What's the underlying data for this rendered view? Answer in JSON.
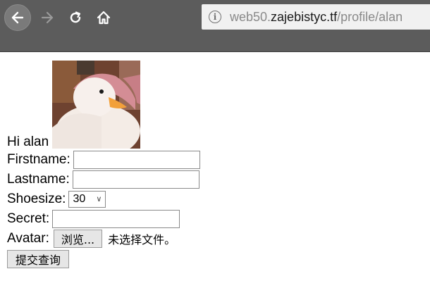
{
  "browser": {
    "url_prefix": "web50.",
    "url_domain": "zajebistyc.tf",
    "url_path": "/profile/alan",
    "icons": [
      "back-arrow-icon",
      "forward-arrow-icon",
      "reload-icon",
      "home-icon",
      "info-icon"
    ]
  },
  "profile": {
    "greeting": "Hi alan",
    "firstname_label": "Firstname:",
    "firstname_value": "",
    "lastname_label": "Lastname:",
    "lastname_value": "",
    "shoesize_label": "Shoesize:",
    "shoesize_value": "30",
    "secret_label": "Secret:",
    "secret_value": "",
    "avatar_label": "Avatar:",
    "browse_button": "浏览...",
    "file_status": "未选择文件。",
    "submit_button": "提交查询"
  }
}
